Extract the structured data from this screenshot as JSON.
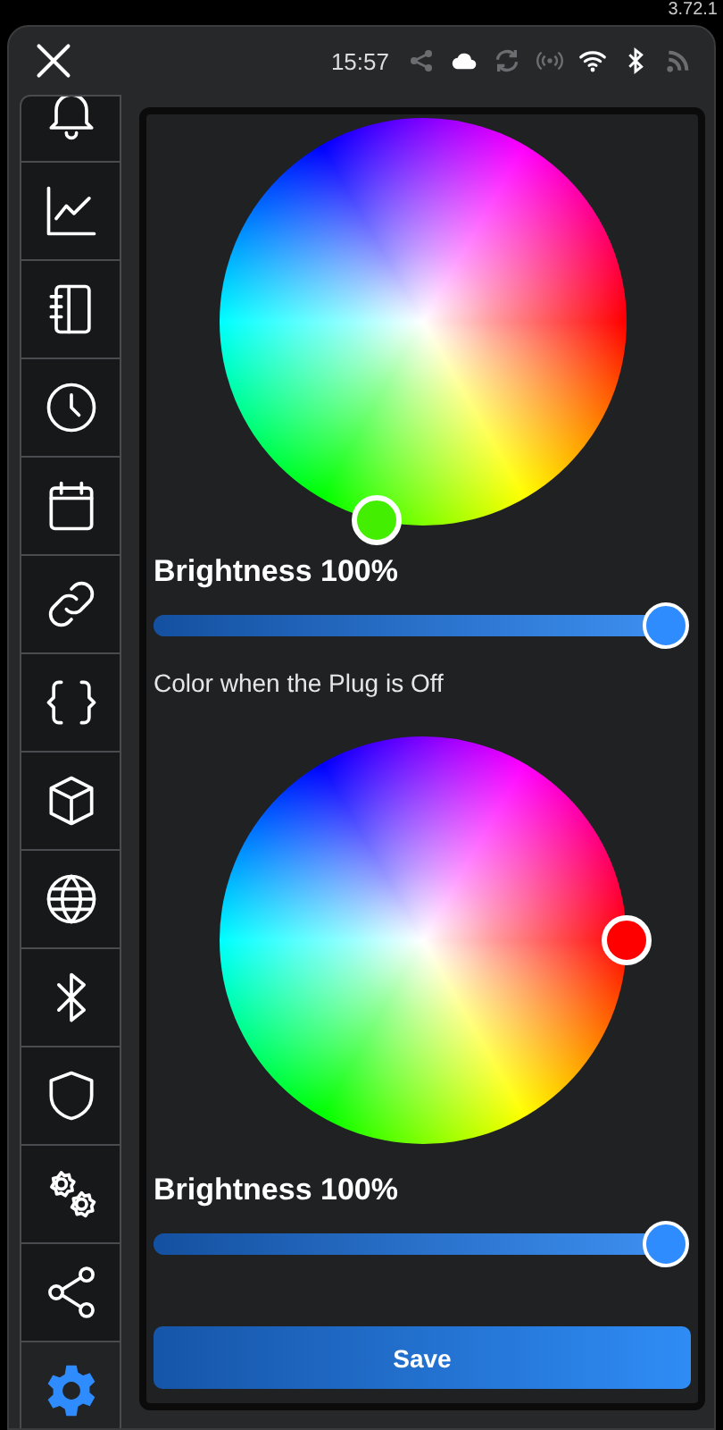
{
  "version": "3.72.1",
  "header": {
    "time": "15:57",
    "status_icons": [
      {
        "kind": "share",
        "active": false
      },
      {
        "kind": "cloud",
        "active": true
      },
      {
        "kind": "sync",
        "active": false
      },
      {
        "kind": "broadcast",
        "active": false
      },
      {
        "kind": "wifi",
        "active": true
      },
      {
        "kind": "bluetooth",
        "active": true
      },
      {
        "kind": "rss",
        "active": false
      }
    ]
  },
  "sidebar": {
    "items": [
      {
        "kind": "bell",
        "selected": false
      },
      {
        "kind": "chart",
        "selected": false
      },
      {
        "kind": "notebook",
        "selected": false
      },
      {
        "kind": "clock",
        "selected": false
      },
      {
        "kind": "calendar",
        "selected": false
      },
      {
        "kind": "link",
        "selected": false
      },
      {
        "kind": "braces",
        "selected": false
      },
      {
        "kind": "cube",
        "selected": false
      },
      {
        "kind": "globe",
        "selected": false
      },
      {
        "kind": "bluetooth",
        "selected": false
      },
      {
        "kind": "shield",
        "selected": false
      },
      {
        "kind": "gears",
        "selected": false
      },
      {
        "kind": "share",
        "selected": false
      },
      {
        "kind": "gear",
        "selected": true
      }
    ]
  },
  "sections": [
    {
      "wheel": {
        "color": "#44ee00"
      },
      "brightness": {
        "label": "Brightness 100%",
        "level": 1
      }
    },
    {
      "caption": "Color when the Plug is Off",
      "wheel": {
        "color": "#ff0000"
      },
      "brightness": {
        "label": "Brightness 100%",
        "level": 1
      }
    }
  ],
  "save_button": "Save"
}
